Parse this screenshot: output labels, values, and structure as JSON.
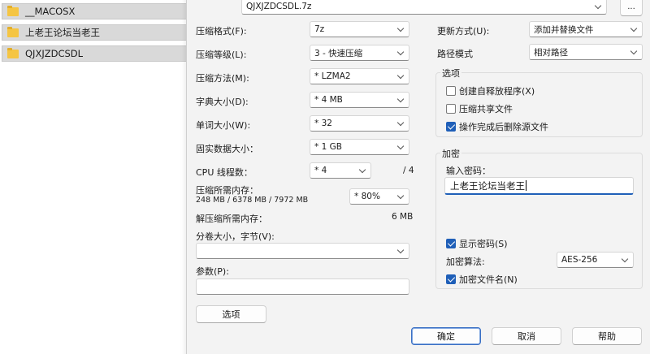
{
  "files": [
    {
      "name": "__MACOSX"
    },
    {
      "name": "上老王论坛当老王"
    },
    {
      "name": "QJXJZDCSDL"
    }
  ],
  "archive": {
    "filename": "QJXJZDCSDL.7z",
    "browse_label": "..."
  },
  "left": {
    "format": {
      "label": "压缩格式(F):",
      "value": "7z"
    },
    "level": {
      "label": "压缩等级(L):",
      "value": "3 - 快速压缩"
    },
    "method": {
      "label": "压缩方法(M):",
      "value": "* LZMA2"
    },
    "dict": {
      "label": "字典大小(D):",
      "value": "* 4 MB"
    },
    "word": {
      "label": "单词大小(W):",
      "value": "* 32"
    },
    "solid": {
      "label": "固实数据大小：",
      "value": "* 1 GB"
    },
    "threads": {
      "label": "CPU 线程数：",
      "value": "* 4",
      "max": "/ 4"
    },
    "mem_compress": {
      "label": "压缩所需内存：",
      "detail": "248 MB / 6378 MB / 7972 MB",
      "value": "* 80%"
    },
    "mem_decompress": {
      "label": "解压缩所需内存：",
      "value": "6 MB"
    },
    "split": {
      "label": "分卷大小，字节(V):",
      "value": ""
    },
    "params": {
      "label": "参数(P):",
      "value": ""
    },
    "options_button": "选项"
  },
  "right": {
    "update": {
      "label": "更新方式(U):",
      "value": "添加并替换文件"
    },
    "path": {
      "label": "路径模式",
      "value": "相对路径"
    },
    "options": {
      "title": "选项",
      "sfx": "创建自释放程序(X)",
      "shared": "压缩共享文件",
      "delete": "操作完成后删除源文件"
    },
    "encryption": {
      "title": "加密",
      "pw_label": "输入密码：",
      "pw_value": "上老王论坛当老王",
      "show_pw": "显示密码(S)",
      "algo_label": "加密算法:",
      "algo_value": "AES-256",
      "encrypt_names": "加密文件名(N)"
    }
  },
  "footer": {
    "ok": "确定",
    "cancel": "取消",
    "help": "帮助"
  },
  "colors": {
    "accent": "#1f5fb8",
    "folder": "#f5c542"
  }
}
